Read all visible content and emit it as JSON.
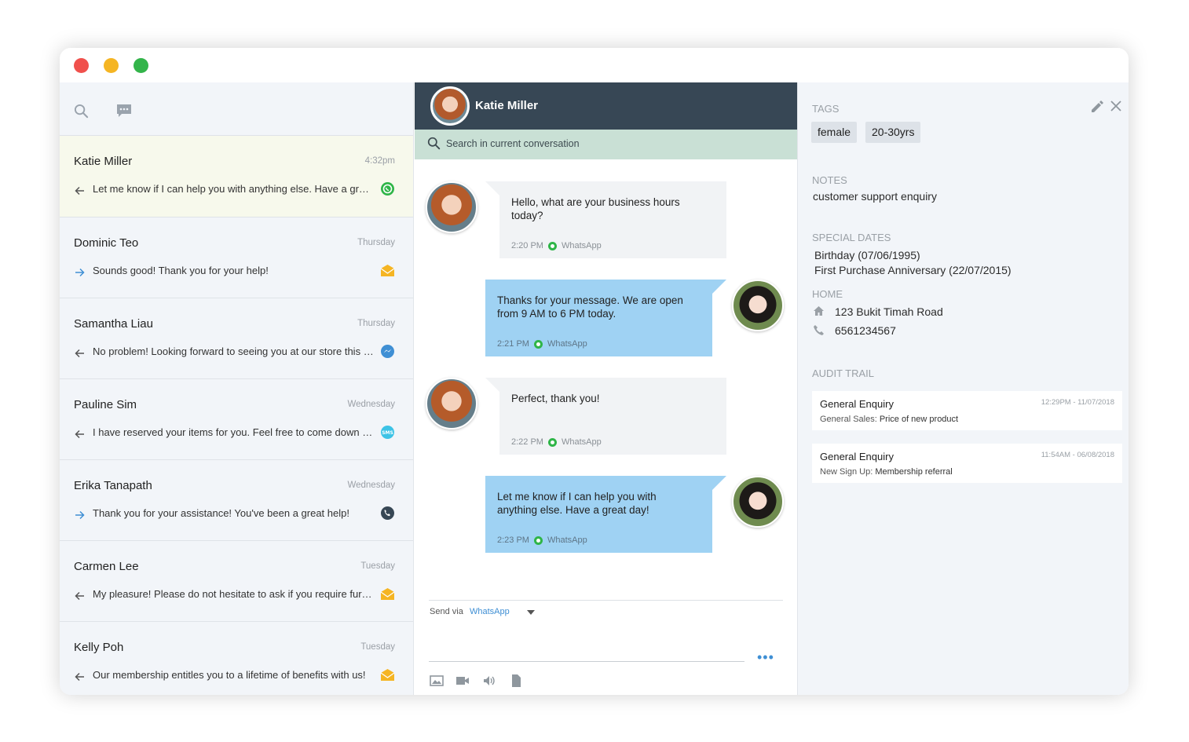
{
  "window": {
    "colors": {
      "close": "#f0504c",
      "minimize": "#f5b523",
      "maximize": "#33b44a"
    }
  },
  "sidebar": {
    "icons": [
      "search-icon",
      "chat-bubble-icon"
    ],
    "conversations": [
      {
        "name": "Katie Miller",
        "time": "4:32pm",
        "direction": "outgoing-left",
        "message": "Let me know if I can help you with anything else. Have a great day!",
        "channel": "whatsapp",
        "active": true
      },
      {
        "name": "Dominic Teo",
        "time": "Thursday",
        "direction": "incoming-right",
        "message": "Sounds good! Thank you for your help!",
        "channel": "email"
      },
      {
        "name": "Samantha Liau",
        "time": "Thursday",
        "direction": "outgoing-left",
        "message": "No problem! Looking forward to seeing you at our store this weekend!",
        "channel": "messenger"
      },
      {
        "name": "Pauline Sim",
        "time": "Wednesday",
        "direction": "outgoing-left",
        "message": "I have reserved your items for you. Feel free to come down anytime!",
        "channel": "sms"
      },
      {
        "name": "Erika Tanapath",
        "time": "Wednesday",
        "direction": "incoming-right",
        "message": "Thank you for your assistance! You've been a great help!",
        "channel": "phone"
      },
      {
        "name": "Carmen Lee",
        "time": "Tuesday",
        "direction": "outgoing-left",
        "message": "My pleasure! Please do not hesitate to ask if you require further help!",
        "channel": "email"
      },
      {
        "name": "Kelly Poh",
        "time": "Tuesday",
        "direction": "outgoing-left",
        "message": "Our membership entitles you to a lifetime of benefits with us!",
        "channel": "email"
      }
    ]
  },
  "chat": {
    "contact_name": "Katie Miller",
    "search_placeholder": "Search in current conversation",
    "messages": [
      {
        "from": "customer",
        "text": "Hello, what are your business hours today?",
        "time": "2:20 PM",
        "channel": "WhatsApp"
      },
      {
        "from": "agent",
        "text": "Thanks for your message. We are open from 9 AM to 6 PM today.",
        "time": "2:21 PM",
        "channel": "WhatsApp"
      },
      {
        "from": "customer",
        "text": "Perfect, thank you!",
        "time": "2:22 PM",
        "channel": "WhatsApp"
      },
      {
        "from": "agent",
        "text": "Let me know if I can help you with anything else. Have a great day!",
        "time": "2:23 PM",
        "channel": "WhatsApp"
      }
    ],
    "composer": {
      "send_via_label": "Send via",
      "send_via_channel": "WhatsApp",
      "more_label": "•••",
      "tools": [
        "image-icon",
        "video-icon",
        "audio-icon",
        "file-icon"
      ]
    }
  },
  "info": {
    "tags_label": "TAGS",
    "tags": [
      "female",
      "20-30yrs"
    ],
    "notes_label": "NOTES",
    "notes": "customer support enquiry",
    "special_dates_label": "SPECIAL DATES",
    "special_dates": [
      "Birthday (07/06/1995)",
      "First Purchase Anniversary (22/07/2015)"
    ],
    "home_label": "HOME",
    "address": "123 Bukit Timah Road",
    "phone": "6561234567",
    "audit_label": "AUDIT TRAIL",
    "audit": [
      {
        "title": "General Enquiry",
        "time": "12:29PM - 11/07/2018",
        "key": "General Sales:",
        "value": "Price of new product"
      },
      {
        "title": "General Enquiry",
        "time": "11:54AM - 06/08/2018",
        "key": "New Sign Up:",
        "value": "Membership referral"
      }
    ]
  }
}
